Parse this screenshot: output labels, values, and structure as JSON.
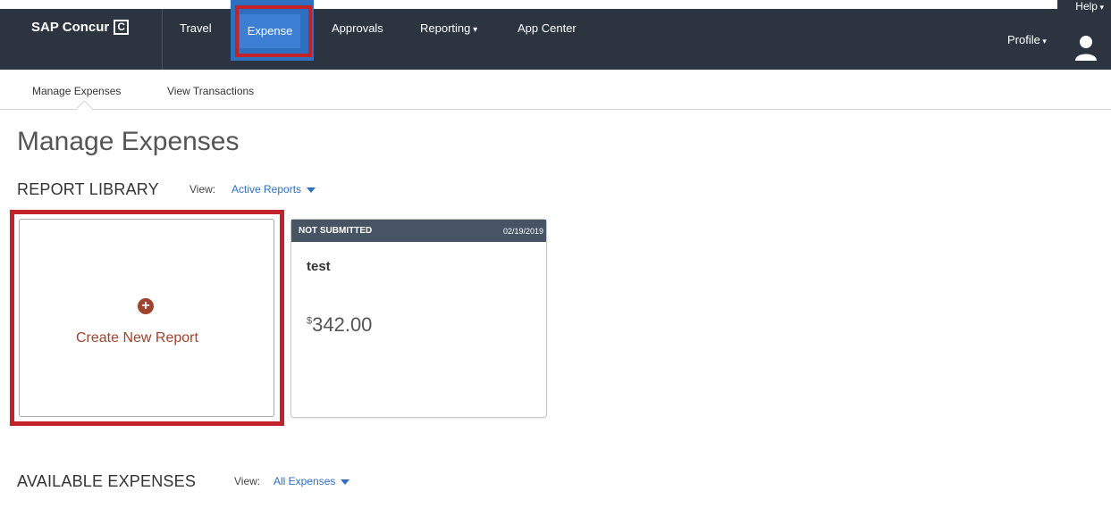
{
  "brand": {
    "name": "SAP Concur",
    "logo_glyph": "C"
  },
  "topnav": {
    "items": [
      {
        "label": "Travel"
      },
      {
        "label": "Expense",
        "active": true
      },
      {
        "label": "Approvals"
      },
      {
        "label": "Reporting"
      },
      {
        "label": "App Center"
      }
    ],
    "help_label": "Help",
    "profile_label": "Profile"
  },
  "subnav": {
    "items": [
      {
        "label": "Manage Expenses"
      },
      {
        "label": "View Transactions"
      }
    ]
  },
  "page": {
    "title": "Manage Expenses"
  },
  "report_library": {
    "title": "REPORT LIBRARY",
    "view_label": "View:",
    "view_value": "Active Reports"
  },
  "create_tile": {
    "label": "Create New Report",
    "icon": "plus-circle-icon"
  },
  "reports": [
    {
      "status": "NOT SUBMITTED",
      "date": "02/19/2019",
      "name": "test",
      "currency_symbol": "$",
      "amount": "342.00"
    }
  ],
  "available_expenses": {
    "title": "AVAILABLE EXPENSES",
    "view_label": "View:",
    "view_value": "All Expenses"
  },
  "colors": {
    "topbar": "#2c3440",
    "active_tab": "#3c7fd4",
    "highlight": "#c3222b",
    "link": "#2e6fbf",
    "create_accent": "#a0432e",
    "card_header": "#475463"
  }
}
